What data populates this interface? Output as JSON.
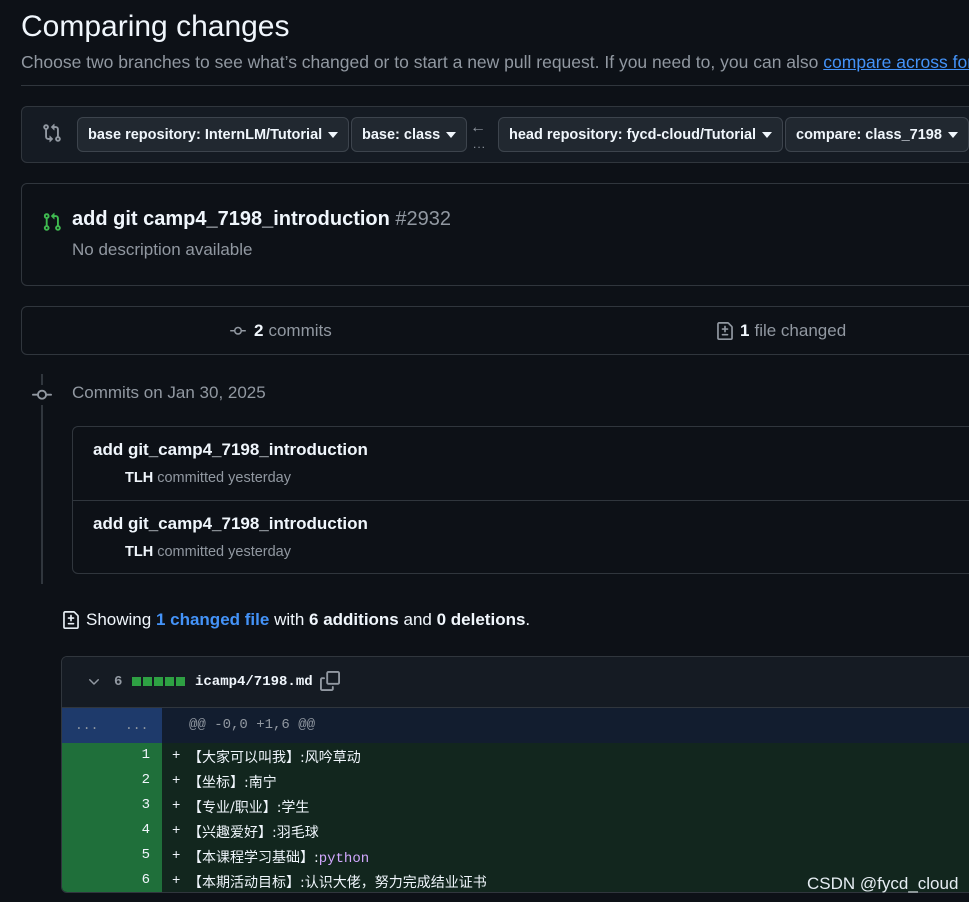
{
  "page": {
    "title": "Comparing changes",
    "subtitle": "Choose two branches to see what’s changed or to start a new pull request. If you need to, you can also",
    "subtitle_link": "compare across forks"
  },
  "range": {
    "base_repo": "base repository: InternLM/Tutorial",
    "base": "base: class",
    "arrow": "←",
    "dots": "...",
    "head_repo": "head repository: fycd-cloud/Tutorial",
    "compare": "compare: class_7198"
  },
  "pr": {
    "title": "add git camp4_7198_introduction",
    "number": "#2932",
    "description": "No description available"
  },
  "summary": {
    "commits_count": "2",
    "commits_label": "commits",
    "files_count": "1",
    "files_label": "file changed"
  },
  "timeline": {
    "date_label": "Commits on Jan 30, 2025",
    "commits": [
      {
        "message": "add git_camp4_7198_introduction",
        "author": "TLH",
        "meta": "committed yesterday"
      },
      {
        "message": "add git_camp4_7198_introduction",
        "author": "TLH",
        "meta": "committed yesterday"
      }
    ]
  },
  "showing": {
    "prefix": "Showing",
    "changed_link": "1 changed file",
    "with": "with",
    "additions": "6 additions",
    "and": "and",
    "deletions": "0 deletions",
    "period": "."
  },
  "diff": {
    "count": "6",
    "filename": "icamp4/7198.md",
    "hunk_left": "...",
    "hunk_right": "...",
    "hunk_header": "@@ -0,0 +1,6 @@",
    "lines": [
      {
        "num": "1",
        "sign": "+",
        "text": "【大家可以叫我】:风吟草动",
        "kw": ""
      },
      {
        "num": "2",
        "sign": "+",
        "text": "【坐标】:南宁",
        "kw": ""
      },
      {
        "num": "3",
        "sign": "+",
        "text": "【专业/职业】:学生",
        "kw": ""
      },
      {
        "num": "4",
        "sign": "+",
        "text": "【兴趣爱好】:羽毛球",
        "kw": ""
      },
      {
        "num": "5",
        "sign": "+",
        "text": "【本课程学习基础】:",
        "kw": "python"
      },
      {
        "num": "6",
        "sign": "+",
        "text": "【本期活动目标】:认识大佬，努力完成结业证书",
        "kw": ""
      }
    ]
  },
  "watermark": "CSDN @fycd_cloud",
  "colors": {
    "accent": "#4493f8",
    "addition": "#2ea043",
    "background": "#0d1117"
  }
}
